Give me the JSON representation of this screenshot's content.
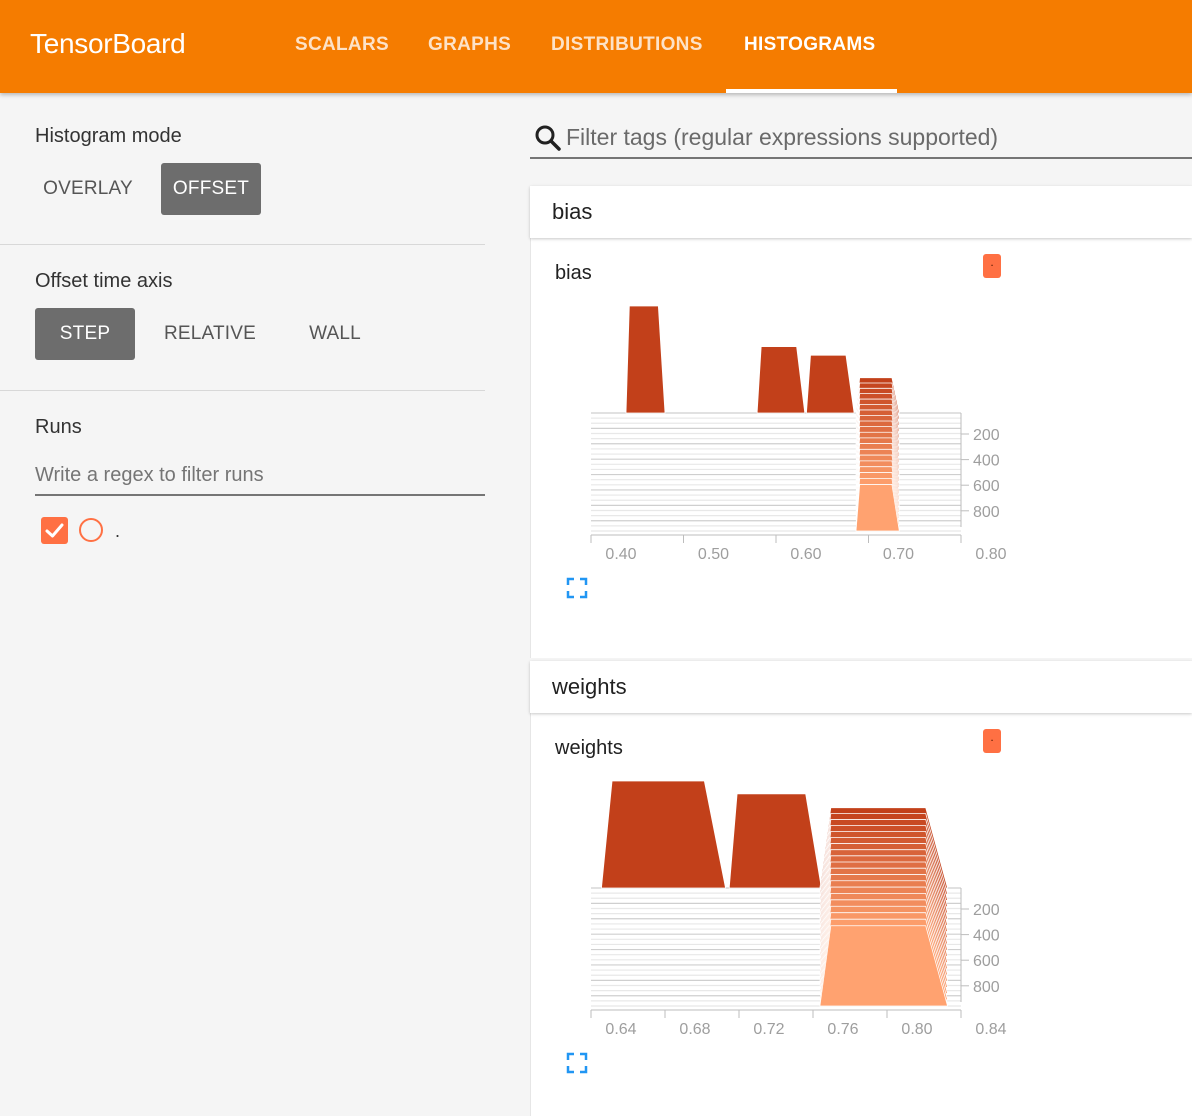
{
  "header": {
    "brand": "TensorBoard",
    "tabs": [
      {
        "label": "SCALARS",
        "active": false
      },
      {
        "label": "GRAPHS",
        "active": false
      },
      {
        "label": "DISTRIBUTIONS",
        "active": false
      },
      {
        "label": "HISTOGRAMS",
        "active": true
      }
    ],
    "bg_color": "#f57c00"
  },
  "sidebar": {
    "histogram_mode": {
      "title": "Histogram mode",
      "options": [
        "OVERLAY",
        "OFFSET"
      ],
      "selected": "OFFSET"
    },
    "offset_time_axis": {
      "title": "Offset time axis",
      "options": [
        "STEP",
        "RELATIVE",
        "WALL"
      ],
      "selected": "STEP"
    },
    "runs": {
      "title": "Runs",
      "filter_placeholder": "Write a regex to filter runs",
      "items": [
        {
          "name": ".",
          "checked": true,
          "color": "#ff7043"
        }
      ]
    }
  },
  "main": {
    "filter_placeholder": "Filter tags (regular expressions supported)",
    "search_icon": "search-icon",
    "cards": [
      {
        "category": "bias",
        "title": "bias",
        "run_chip": "."
      },
      {
        "category": "weights",
        "title": "weights",
        "run_chip": "."
      }
    ]
  },
  "chart_data": [
    {
      "type": "histogram-offset",
      "title": "bias",
      "x_ticks": [
        "0.40",
        "0.50",
        "0.60",
        "0.70",
        "0.80"
      ],
      "xlim": [
        0.35,
        0.8
      ],
      "y_ticks": [
        "200",
        "400",
        "600",
        "800"
      ],
      "back_color": "#c2401a",
      "front_color": "#ffa270",
      "back_slice": [
        {
          "x0": 0.395,
          "x1": 0.44,
          "peak": 1.0
        },
        {
          "x0": 0.555,
          "x1": 0.61,
          "peak": 0.62
        },
        {
          "x0": 0.615,
          "x1": 0.67,
          "peak": 0.54
        },
        {
          "x0": 0.675,
          "x1": 0.725,
          "peak": 0.33
        }
      ]
    },
    {
      "type": "histogram-offset",
      "title": "weights",
      "x_ticks": [
        "0.64",
        "0.68",
        "0.72",
        "0.76",
        "0.80",
        "0.84"
      ],
      "xlim": [
        0.62,
        0.84
      ],
      "y_ticks": [
        "200",
        "400",
        "600",
        "800"
      ],
      "back_color": "#c2401a",
      "front_color": "#ffa270",
      "back_slice": [
        {
          "x0": 0.63,
          "x1": 0.7,
          "peak": 1.0
        },
        {
          "x0": 0.705,
          "x1": 0.757,
          "peak": 0.88
        },
        {
          "x0": 0.76,
          "x1": 0.832,
          "peak": 0.75
        }
      ]
    }
  ]
}
